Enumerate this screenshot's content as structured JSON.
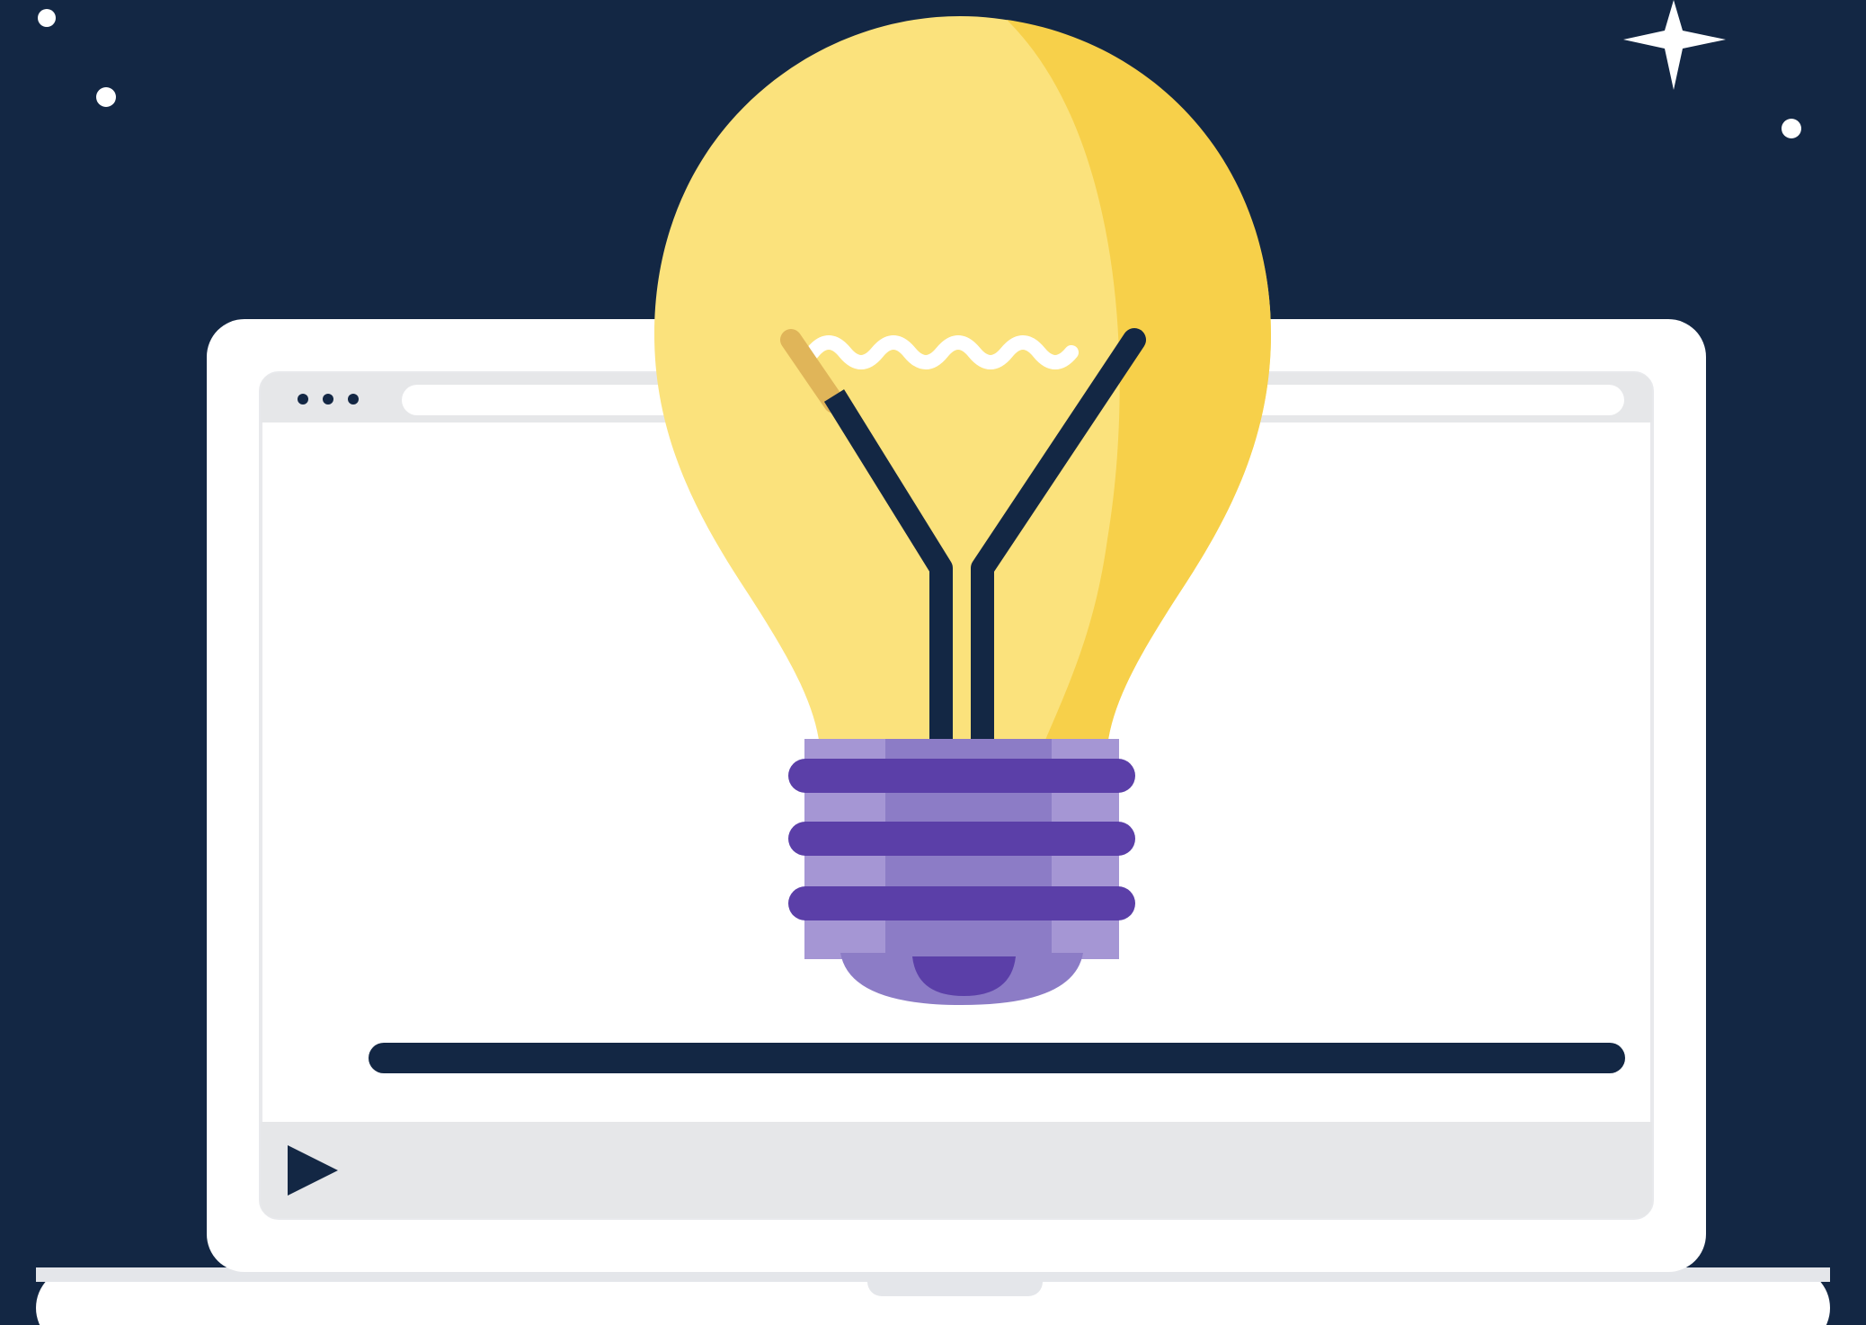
{
  "colors": {
    "background": "#132744",
    "laptop_frame": "#ffffff",
    "screen": "#ffffff",
    "browser_bar": "#e6e7e9",
    "navy": "#132744",
    "bulb_light": "#fbe27c",
    "bulb_dark": "#f7d04a",
    "base_purple": "#5b3fa8",
    "base_lavender": "#a596d4",
    "star": "#ffffff"
  },
  "icons": {
    "browser_menu": "three-dots-icon",
    "play": "play-icon",
    "idea": "lightbulb-icon",
    "star": "sparkle-star-icon"
  },
  "video_player": {
    "progress": 1.0
  }
}
